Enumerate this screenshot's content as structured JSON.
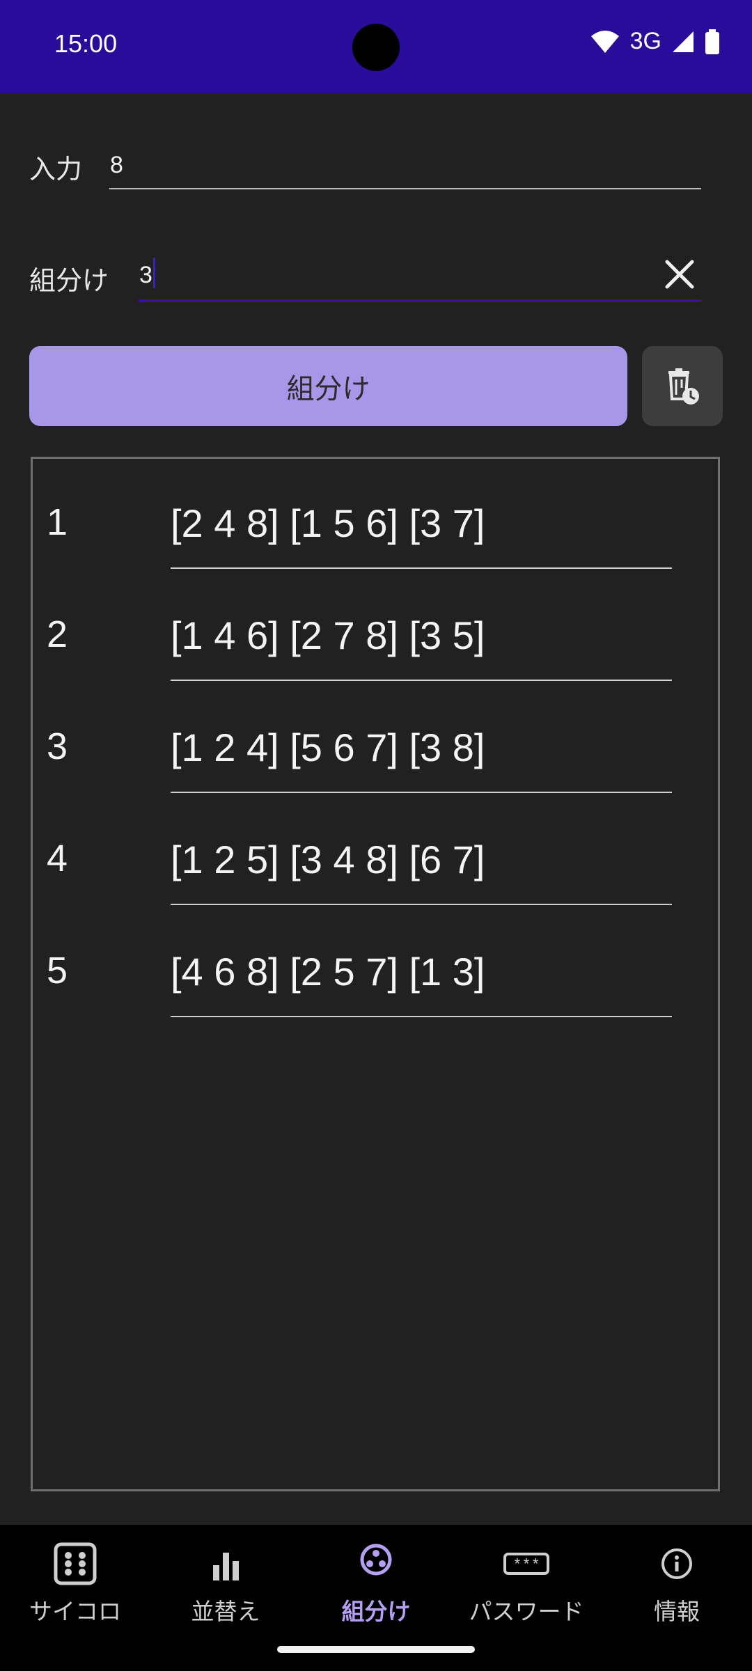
{
  "status": {
    "time": "15:00",
    "network": "3G",
    "icons": [
      "wifi-icon",
      "signal-icon",
      "battery-icon"
    ]
  },
  "form": {
    "input_label": "入力",
    "input_value": "8",
    "group_label": "組分け",
    "group_value": "3"
  },
  "actions": {
    "group_button_label": "組分け",
    "delete_history_icon": "delete-history-icon"
  },
  "results": [
    {
      "index": "1",
      "value": "[2 4 8] [1 5 6] [3 7]"
    },
    {
      "index": "2",
      "value": "[1 4 6] [2 7 8] [3 5]"
    },
    {
      "index": "3",
      "value": "[1 2 4] [5 6 7] [3 8]"
    },
    {
      "index": "4",
      "value": "[1 2 5] [3 4 8] [6 7]"
    },
    {
      "index": "5",
      "value": "[4 6 8] [2 5 7] [1 3]"
    }
  ],
  "nav": {
    "items": [
      {
        "label": "サイコロ",
        "icon": "dice-icon"
      },
      {
        "label": "並替え",
        "icon": "bar-chart-icon"
      },
      {
        "label": "組分け",
        "icon": "group-icon",
        "active": true
      },
      {
        "label": "パスワード",
        "icon": "password-icon"
      },
      {
        "label": "情報",
        "icon": "info-icon"
      }
    ]
  },
  "colors": {
    "status_bar": "#2a0c9a",
    "accent": "#a897e8",
    "background": "#212121",
    "active_nav": "#b49ff0"
  }
}
